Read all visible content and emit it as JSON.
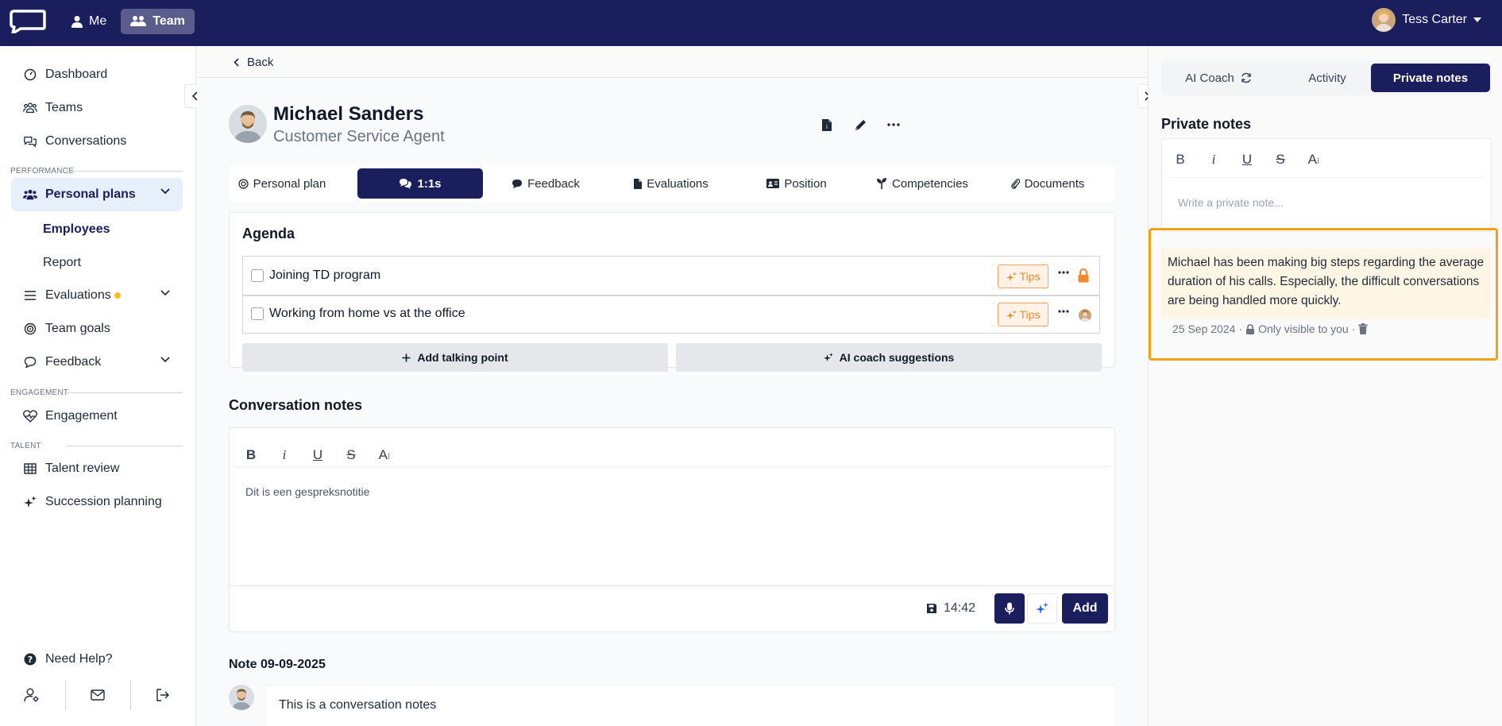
{
  "topbar": {
    "nav": [
      {
        "label": "Me",
        "icon": "user-icon"
      },
      {
        "label": "Team",
        "icon": "team-icon"
      }
    ],
    "user_name": "Tess Carter"
  },
  "sidebar": {
    "dashboard": "Dashboard",
    "teams": "Teams",
    "conversations": "Conversations",
    "section_performance": "PERFORMANCE",
    "personal_plans": "Personal plans",
    "employees": "Employees",
    "report": "Report",
    "evaluations": "Evaluations",
    "team_goals": "Team goals",
    "feedback": "Feedback",
    "section_engagement": "ENGAGEMENT",
    "engagement": "Engagement",
    "section_talent": "TALENT",
    "talent_review": "Talent review",
    "succession_planning": "Succession planning",
    "need_help": "Need Help?"
  },
  "main": {
    "back": "Back",
    "profile": {
      "name": "Michael Sanders",
      "role": "Customer Service Agent"
    },
    "tabs": [
      "Personal plan",
      "1:1s",
      "Feedback",
      "Evaluations",
      "Position",
      "Competencies",
      "Documents"
    ],
    "active_tab": "1:1s",
    "agenda": {
      "title": "Agenda",
      "items": [
        {
          "text": "Joining TD program",
          "tips": "Tips"
        },
        {
          "text": "Working from home vs at the office",
          "tips": "Tips"
        }
      ],
      "add_talking_point": "Add talking point",
      "ai_suggestions": "AI coach suggestions"
    },
    "conversation_notes": {
      "title": "Conversation notes",
      "content": "Dit is een gespreksnotitie",
      "saved_time": "14:42",
      "add": "Add"
    },
    "note": {
      "title": "Note 09-09-2025",
      "text": "This is a conversation notes"
    }
  },
  "right_panel": {
    "tabs": [
      "AI Coach",
      "Activity",
      "Private notes"
    ],
    "active_tab": "Private notes",
    "title": "Private notes",
    "placeholder": "Write a private note...",
    "note_text": "Michael has been making big steps regarding the average duration of his calls. Especially, the difficult conversations are being handled more quickly.",
    "note_date": "25 Sep 2024",
    "note_visibility": "Only visible to you"
  },
  "colors": {
    "navy": "#1b1e5c",
    "accent_orange": "#f0a21a",
    "tips_orange": "#f08a2c",
    "note_bg": "#fdf6e5",
    "active_nav_bg": "#e6effa",
    "evaluations_dot": "#f6c21b"
  }
}
